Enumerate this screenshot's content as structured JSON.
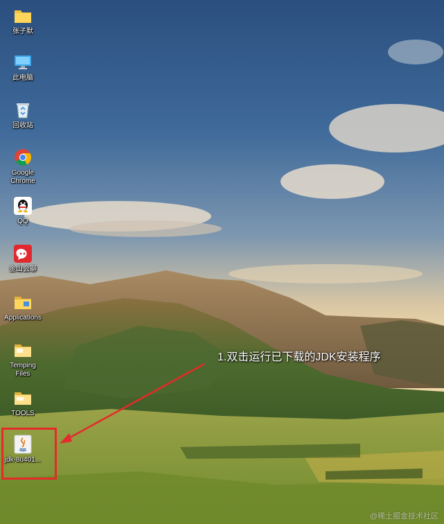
{
  "desktop": {
    "icons": [
      {
        "label": "张子默",
        "icon": "folder-icon"
      },
      {
        "label": "此电脑",
        "icon": "computer-icon"
      },
      {
        "label": "回收站",
        "icon": "recycle-bin-icon"
      },
      {
        "label": "Google\nChrome",
        "icon": "chrome-icon"
      },
      {
        "label": "QQ",
        "icon": "qq-icon"
      },
      {
        "label": "金山会聊",
        "icon": "chat-app-icon"
      },
      {
        "label": "Applications",
        "icon": "folder-icon"
      },
      {
        "label": "Temping\nFiles",
        "icon": "folder-icon"
      },
      {
        "label": "TOOLS",
        "icon": "folder-icon"
      },
      {
        "label": "jdk-8u401...",
        "icon": "java-installer-icon"
      }
    ]
  },
  "annotation": {
    "text": "1.双击运行已下载的JDK安装程序",
    "color": "#e52a2a"
  },
  "watermark": "@稀土掘金技术社区"
}
